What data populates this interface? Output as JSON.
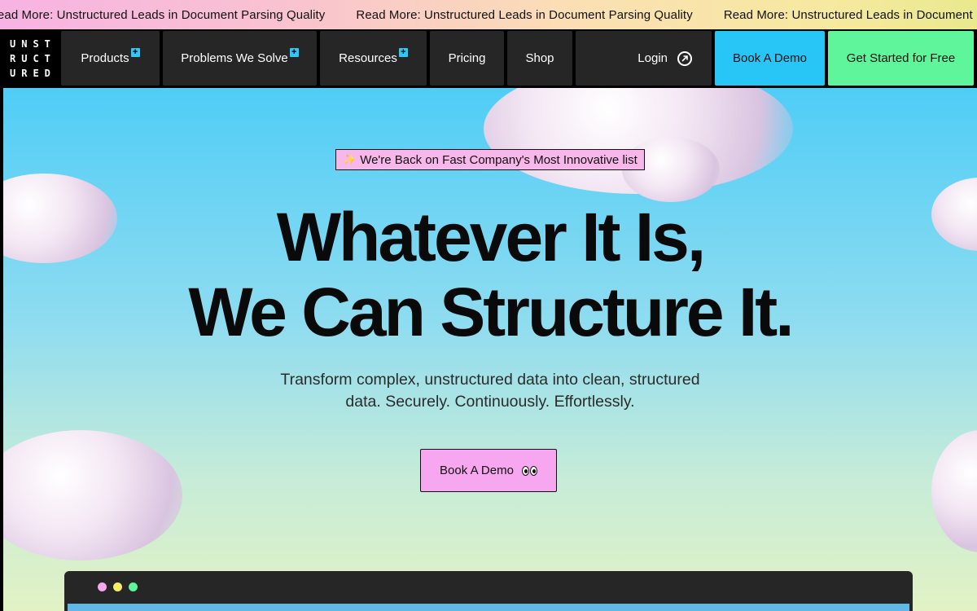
{
  "ticker": {
    "items": [
      "Read More: Unstructured Leads in Document Parsing Quality",
      "Read More: Unstructured Leads in Document Parsing Quality",
      "Read More: Unstructured Leads in Document Parsing Quality"
    ]
  },
  "nav": {
    "logo_lines": [
      "UNST",
      "RUCT",
      "URED"
    ],
    "products": "Products",
    "problems": "Problems We Solve",
    "resources": "Resources",
    "pricing": "Pricing",
    "shop": "Shop",
    "login": "Login",
    "book_demo": "Book A Demo",
    "get_started": "Get Started for Free",
    "plus_glyph": "+",
    "accent_blue": "#28c6f7",
    "accent_green": "#5ff59a"
  },
  "hero": {
    "badge_icon": "sparkle-icon",
    "badge_glyph": "✨",
    "badge": "We're Back on Fast Company's Most Innovative list",
    "headline_line1": "Whatever It Is,",
    "headline_line2": "We Can Structure It.",
    "subtitle_line1": "Transform complex, unstructured data into clean, structured",
    "subtitle_line2": "data. Securely. Continuously. Effortlessly.",
    "cta": "Book A Demo",
    "cta_icon": "eyes-icon",
    "cta_color": "#f7a7ef"
  },
  "window": {
    "dot_colors": [
      "#f7a7ef",
      "#f6ec6b",
      "#5ff59a"
    ]
  }
}
